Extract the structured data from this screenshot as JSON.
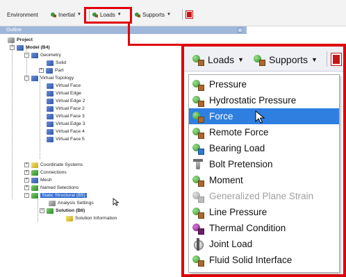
{
  "toolbar": {
    "environment_label": "Environment",
    "inertial_label": "Inertial",
    "loads_label": "Loads",
    "supports_label": "Supports"
  },
  "outline": {
    "header_title": "Outline"
  },
  "tree": {
    "project": "Project",
    "model": "Model (B4)",
    "geometry": "Geometry",
    "solid": "Solid",
    "part": "Part",
    "virtual_topology": "Virtual Topology",
    "virtual_items": [
      "Virtual Face",
      "Virtual Edge",
      "Virtual Edge 2",
      "Virtual Face 2",
      "Virtual Face 3",
      "Virtual Edge 3",
      "Virtual Face 4",
      "Virtual Face 5"
    ],
    "coordinate_systems": "Coordinate Systems",
    "connections": "Connections",
    "mesh": "Mesh",
    "named_selections": "Named Selections",
    "static_structural": "Static Structural (B5)",
    "analysis_settings": "Analysis Settings",
    "solution": "Solution (B6)",
    "solution_information": "Solution Information"
  },
  "zoom": {
    "loads_label": "Loads",
    "supports_label": "Supports",
    "menu_items": [
      {
        "label": "Pressure",
        "icon": "pressure-icon",
        "state": "normal"
      },
      {
        "label": "Hydrostatic Pressure",
        "icon": "hydrostatic-pressure-icon",
        "state": "normal"
      },
      {
        "label": "Force",
        "icon": "force-icon",
        "state": "highlighted"
      },
      {
        "label": "Remote Force",
        "icon": "remote-force-icon",
        "state": "normal"
      },
      {
        "label": "Bearing Load",
        "icon": "bearing-load-icon",
        "state": "normal"
      },
      {
        "label": "Bolt Pretension",
        "icon": "bolt-pretension-icon",
        "state": "normal"
      },
      {
        "label": "Moment",
        "icon": "moment-icon",
        "state": "normal"
      },
      {
        "label": "Generalized Plane Strain",
        "icon": "generalized-plane-strain-icon",
        "state": "disabled"
      },
      {
        "label": "Line Pressure",
        "icon": "line-pressure-icon",
        "state": "normal"
      },
      {
        "label": "Thermal Condition",
        "icon": "thermal-condition-icon",
        "state": "normal"
      },
      {
        "label": "Joint Load",
        "icon": "joint-load-icon",
        "state": "normal"
      },
      {
        "label": "Fluid Solid Interface",
        "icon": "fluid-solid-interface-icon",
        "state": "normal"
      }
    ]
  },
  "colors": {
    "highlight_red": "#e0000b",
    "menu_highlight": "#2f7fe0",
    "outline_header": "#9fb7d9"
  }
}
